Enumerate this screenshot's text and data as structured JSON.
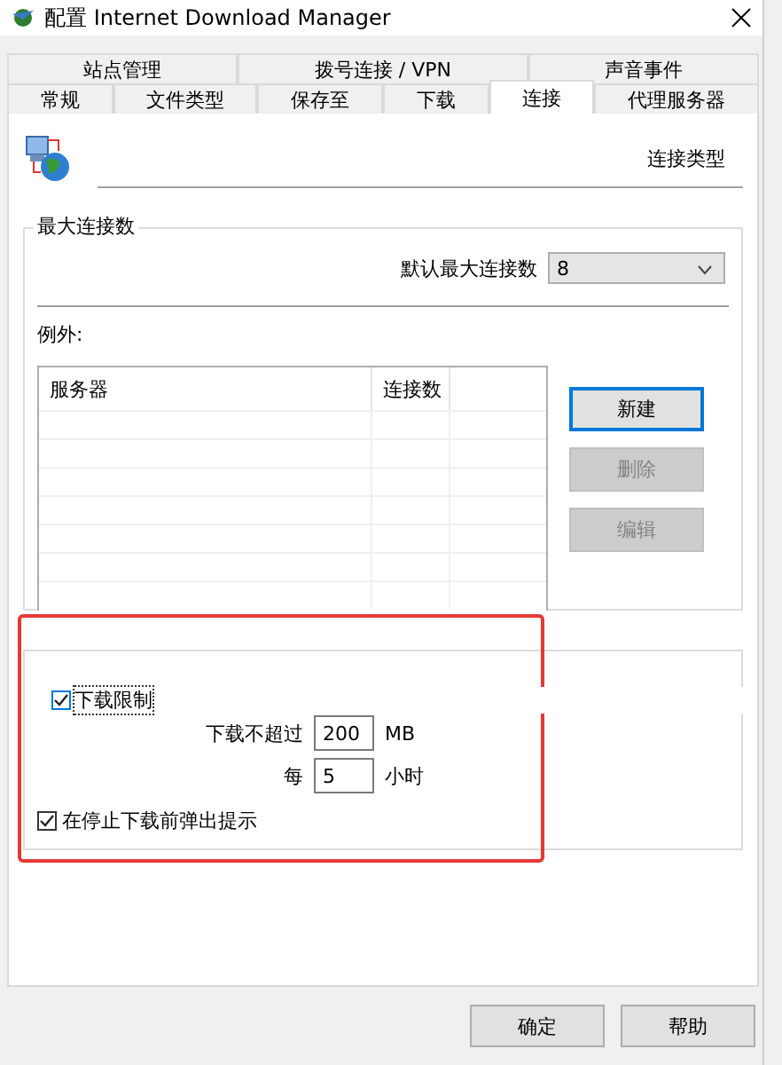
{
  "window": {
    "title": "配置 Internet Download Manager"
  },
  "tab_rows": [
    [
      {
        "label": "站点管理",
        "selected": false
      },
      {
        "label": "拨号连接 / VPN",
        "selected": false
      },
      {
        "label": "声音事件",
        "selected": false
      }
    ],
    [
      {
        "label": "常规",
        "selected": false
      },
      {
        "label": "文件类型",
        "selected": false
      },
      {
        "label": "保存至",
        "selected": false
      },
      {
        "label": "下载",
        "selected": false
      },
      {
        "label": "连接",
        "selected": true
      },
      {
        "label": "代理服务器",
        "selected": false
      }
    ]
  ],
  "header": {
    "label": "连接类型"
  },
  "max_connections": {
    "title": "最大连接数",
    "default_label": "默认最大连接数",
    "default_value": "8",
    "exceptions_label": "例外:",
    "columns": [
      "服务器",
      "连接数"
    ],
    "buttons": [
      {
        "label": "新建",
        "disabled": false,
        "focused": true
      },
      {
        "label": "删除",
        "disabled": true,
        "focused": false
      },
      {
        "label": "编辑",
        "disabled": true,
        "focused": false
      }
    ]
  },
  "limit": {
    "highlighted": true,
    "checked": true,
    "label": "下载限制",
    "amount_label": "下载不超过",
    "amount": "200",
    "amount_unit": "MB",
    "period_label": "每",
    "period": "5",
    "period_unit": "小时",
    "prompt_checked": true,
    "prompt_label": "在停止下载前弹出提示"
  },
  "footer_buttons": [
    "确定",
    "帮助"
  ]
}
